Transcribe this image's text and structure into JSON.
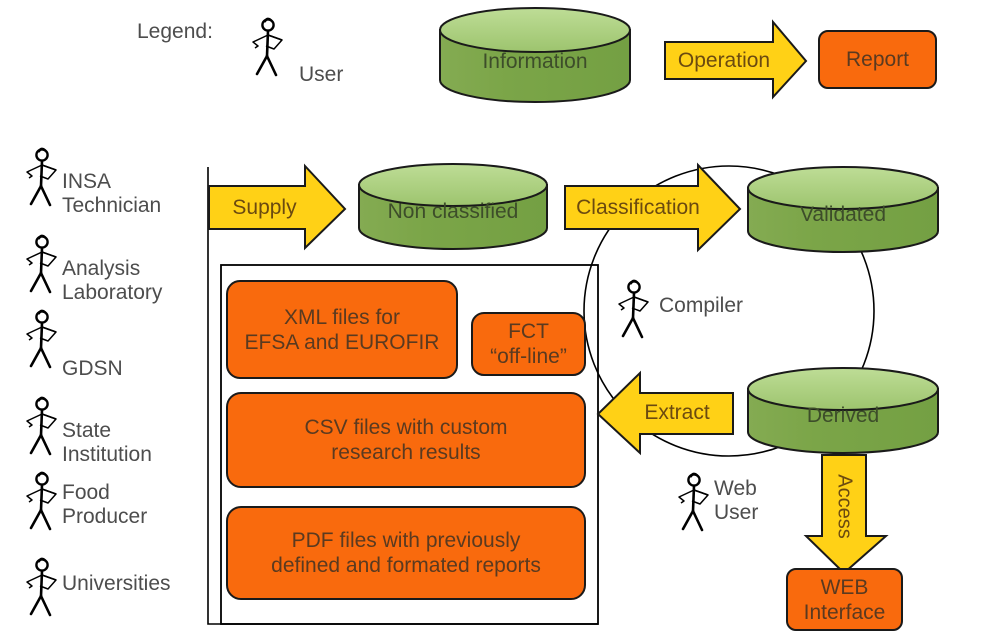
{
  "legend": {
    "title": "Legend:",
    "user_label": "User",
    "information_label": "Information",
    "operation_label": "Operation",
    "report_label": "Report"
  },
  "actors": [
    {
      "id": "insa-technician",
      "label": "INSA\nTechnician"
    },
    {
      "id": "analysis-laboratory",
      "label": "Analysis\nLaboratory"
    },
    {
      "id": "gdsn",
      "label": "GDSN"
    },
    {
      "id": "state-institution",
      "label": "State\nInstitution"
    },
    {
      "id": "food-producer",
      "label": "Food\nProducer"
    },
    {
      "id": "universities",
      "label": "Universities"
    }
  ],
  "flow": {
    "supply_label": "Supply",
    "non_classified_label": "Non classified",
    "classification_label": "Classification",
    "validated_label": "Validated",
    "derived_label": "Derived",
    "extract_label": "Extract",
    "access_label": "Access",
    "compiler_label": "Compiler",
    "web_user_label": "Web\nUser",
    "web_interface_label": "WEB\nInterface"
  },
  "outputs": [
    {
      "id": "xml-files",
      "label": "XML files for\nEFSA and EUROFIR"
    },
    {
      "id": "fct-offline",
      "label": "FCT\n“off-line”"
    },
    {
      "id": "csv-files",
      "label": "CSV files with custom\nresearch results"
    },
    {
      "id": "pdf-files",
      "label": "PDF files with previously\ndefined and formated reports"
    }
  ],
  "colors": {
    "cylinder_body": "#7ba548",
    "cylinder_top": "#a9cd7c",
    "cylinder_stroke": "#1a1a1a",
    "arrow_fill": "#ffd116",
    "arrow_stroke": "#1a1a1a",
    "box_fill": "#f96a0d",
    "box_stroke": "#1a1a1a",
    "panel_stroke": "#000000",
    "circle_stroke": "#000000",
    "text_gray": "#4d4d4d",
    "background": "#ffffff"
  }
}
